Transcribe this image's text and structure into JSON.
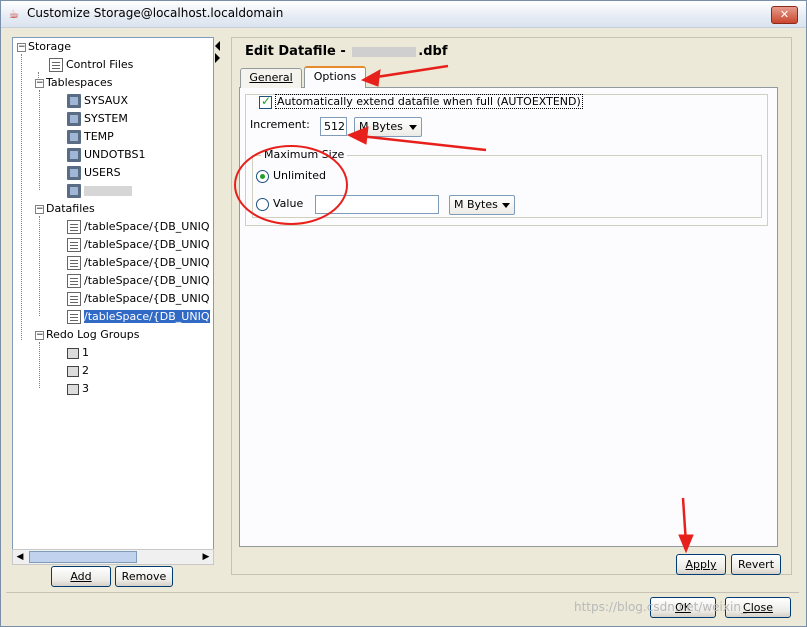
{
  "window": {
    "title": "Customize Storage@localhost.localdomain",
    "close_glyph": "✕"
  },
  "tree": {
    "nodes": [
      {
        "label": "Storage",
        "expander": "−",
        "icon": "none"
      },
      {
        "label": "Control Files",
        "icon": "file-icon"
      },
      {
        "label": "Tablespaces",
        "expander": "−",
        "icon": "none"
      },
      {
        "label": "SYSAUX",
        "icon": "database-icon"
      },
      {
        "label": "SYSTEM",
        "icon": "database-icon"
      },
      {
        "label": "TEMP",
        "icon": "database-icon"
      },
      {
        "label": "UNDOTBS1",
        "icon": "database-icon"
      },
      {
        "label": "USERS",
        "icon": "database-icon"
      },
      {
        "label": "",
        "icon": "database-icon"
      },
      {
        "label": "Datafiles",
        "expander": "−",
        "icon": "none"
      },
      {
        "label": "/tableSpace/{DB_UNIQ",
        "icon": "file-icon"
      },
      {
        "label": "/tableSpace/{DB_UNIQ",
        "icon": "file-icon"
      },
      {
        "label": "/tableSpace/{DB_UNIQ",
        "icon": "file-icon"
      },
      {
        "label": "/tableSpace/{DB_UNIQ",
        "icon": "file-icon"
      },
      {
        "label": "/tableSpace/{DB_UNIQ",
        "icon": "file-icon"
      },
      {
        "label": "/tableSpace/{DB_UNIQ",
        "icon": "file-icon",
        "selected": true
      },
      {
        "label": "Redo Log Groups",
        "expander": "−",
        "icon": "none"
      },
      {
        "label": "1",
        "icon": "log-group-icon"
      },
      {
        "label": "2",
        "icon": "log-group-icon"
      },
      {
        "label": "3",
        "icon": "log-group-icon"
      }
    ]
  },
  "left_buttons": {
    "add": "Add",
    "remove": "Remove"
  },
  "editor": {
    "title_prefix": "Edit Datafile - ",
    "title_suffix": ".dbf",
    "tabs": [
      {
        "label": "General",
        "active": false
      },
      {
        "label": "Options",
        "active": true
      }
    ],
    "autoextend_label": "Automatically extend datafile when full (AUTOEXTEND)",
    "autoextend_checked": true,
    "increment_label": "Increment:",
    "increment_value": "512",
    "increment_unit": "M Bytes",
    "max_size_title": "Maximum Size",
    "unlimited_label": "Unlimited",
    "unlimited_selected": true,
    "value_label": "Value",
    "value_input": "",
    "value_unit": "M Bytes"
  },
  "panel_buttons": {
    "apply": "Apply",
    "revert": "Revert"
  },
  "dialog_buttons": {
    "ok": "OK",
    "close": "Close"
  },
  "watermark": "https://blog.csdn.net/weixin_",
  "colors": {
    "annotation_red": "#e8201c",
    "selection": "#316ac5",
    "check_green": "#21a121"
  }
}
